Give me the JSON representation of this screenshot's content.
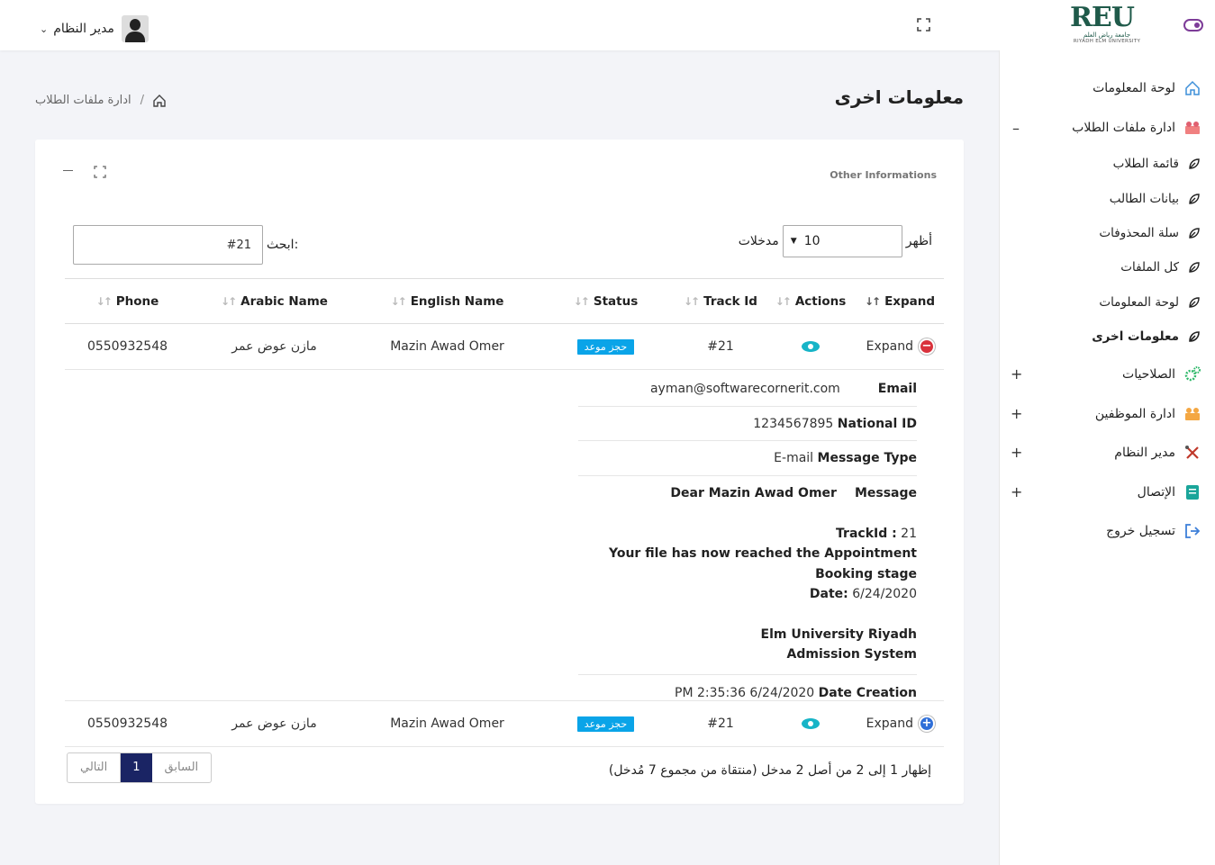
{
  "header": {
    "user_name": "مدير النظام",
    "logo_text": "REU",
    "logo_ar": "جامعة رياض العلم",
    "logo_en": "RIYADH ELM UNIVERSITY"
  },
  "sidebar": {
    "items": [
      {
        "label": "لوحة المعلومات",
        "icon": "home-icon"
      },
      {
        "label": "ادارة ملفات الطلاب",
        "icon": "students-icon",
        "toggle": "–"
      },
      {
        "label": "قائمة الطلاب",
        "icon": "leaf-icon"
      },
      {
        "label": "بيانات الطالب",
        "icon": "leaf-icon"
      },
      {
        "label": "سلة المحذوفات",
        "icon": "leaf-icon"
      },
      {
        "label": "كل الملفات",
        "icon": "leaf-icon"
      },
      {
        "label": "لوحة المعلومات",
        "icon": "leaf-icon"
      },
      {
        "label": "معلومات اخرى",
        "icon": "leaf-icon"
      },
      {
        "label": "الصلاحيات",
        "icon": "gears-icon",
        "toggle": "+"
      },
      {
        "label": "ادارة الموظفين",
        "icon": "staff-icon",
        "toggle": "+"
      },
      {
        "label": "مدير النظام",
        "icon": "tools-icon",
        "toggle": "+"
      },
      {
        "label": "الإتصال",
        "icon": "contact-icon",
        "toggle": "+"
      },
      {
        "label": "تسجيل خروج",
        "icon": "logout-icon"
      }
    ]
  },
  "page": {
    "title": "معلومات اخرى",
    "breadcrumb": "ادارة ملفات الطلاب",
    "breadcrumb_sep": "/"
  },
  "card": {
    "title": "Other Informations",
    "length_show": "أظهر",
    "length_value": "10",
    "length_entries": "مدخلات",
    "search_label": "ابحث:",
    "search_value": "#21"
  },
  "table": {
    "columns": [
      "Expand",
      "Actions",
      "Track Id",
      "Status",
      "English Name",
      "Arabic Name",
      "Phone"
    ],
    "rows": [
      {
        "expand": "Expand",
        "track_id": "#21",
        "status": "حجز موعد",
        "english_name": "Mazin Awad Omer",
        "arabic_name": "مازن عوض عمر",
        "phone": "0550932548"
      },
      {
        "expand": "Expand",
        "track_id": "#21",
        "status": "حجز موعد",
        "english_name": "Mazin Awad Omer",
        "arabic_name": "مازن عوض عمر",
        "phone": "0550932548"
      }
    ]
  },
  "detail": {
    "email_label": "Email",
    "email_value": "ayman@softwarecornerit.com",
    "nid_value": "1234567895",
    "nid_label": "National ID",
    "mt_value": "E-mail",
    "mt_label": "Message Type",
    "msg_head": "Dear Mazin Awad Omer",
    "msg_label": "Message",
    "track_label": "TrackId :",
    "track_value": "21",
    "stage_line": "Your file has now reached the Appointment Booking stage",
    "date_label": "Date:",
    "date_value": "6/24/2020",
    "sig1": "Elm University Riyadh",
    "sig2": "Admission System",
    "created_value": "PM 2:35:36 6/24/2020",
    "created_label": "Date Creation"
  },
  "footer": {
    "info": "إظهار 1 إلى 2 من أصل 2 مدخل (منتقاة من مجموع 7 مُدخل)",
    "prev": "السابق",
    "page": "1",
    "next": "التالي"
  },
  "colors": {
    "badge": "#0aa4e8",
    "pager_active": "#1a2464",
    "eye": "#17b4c7",
    "collapse": "#d9323c",
    "expand": "#2f6fd8",
    "toggle": "#7d3c98"
  }
}
